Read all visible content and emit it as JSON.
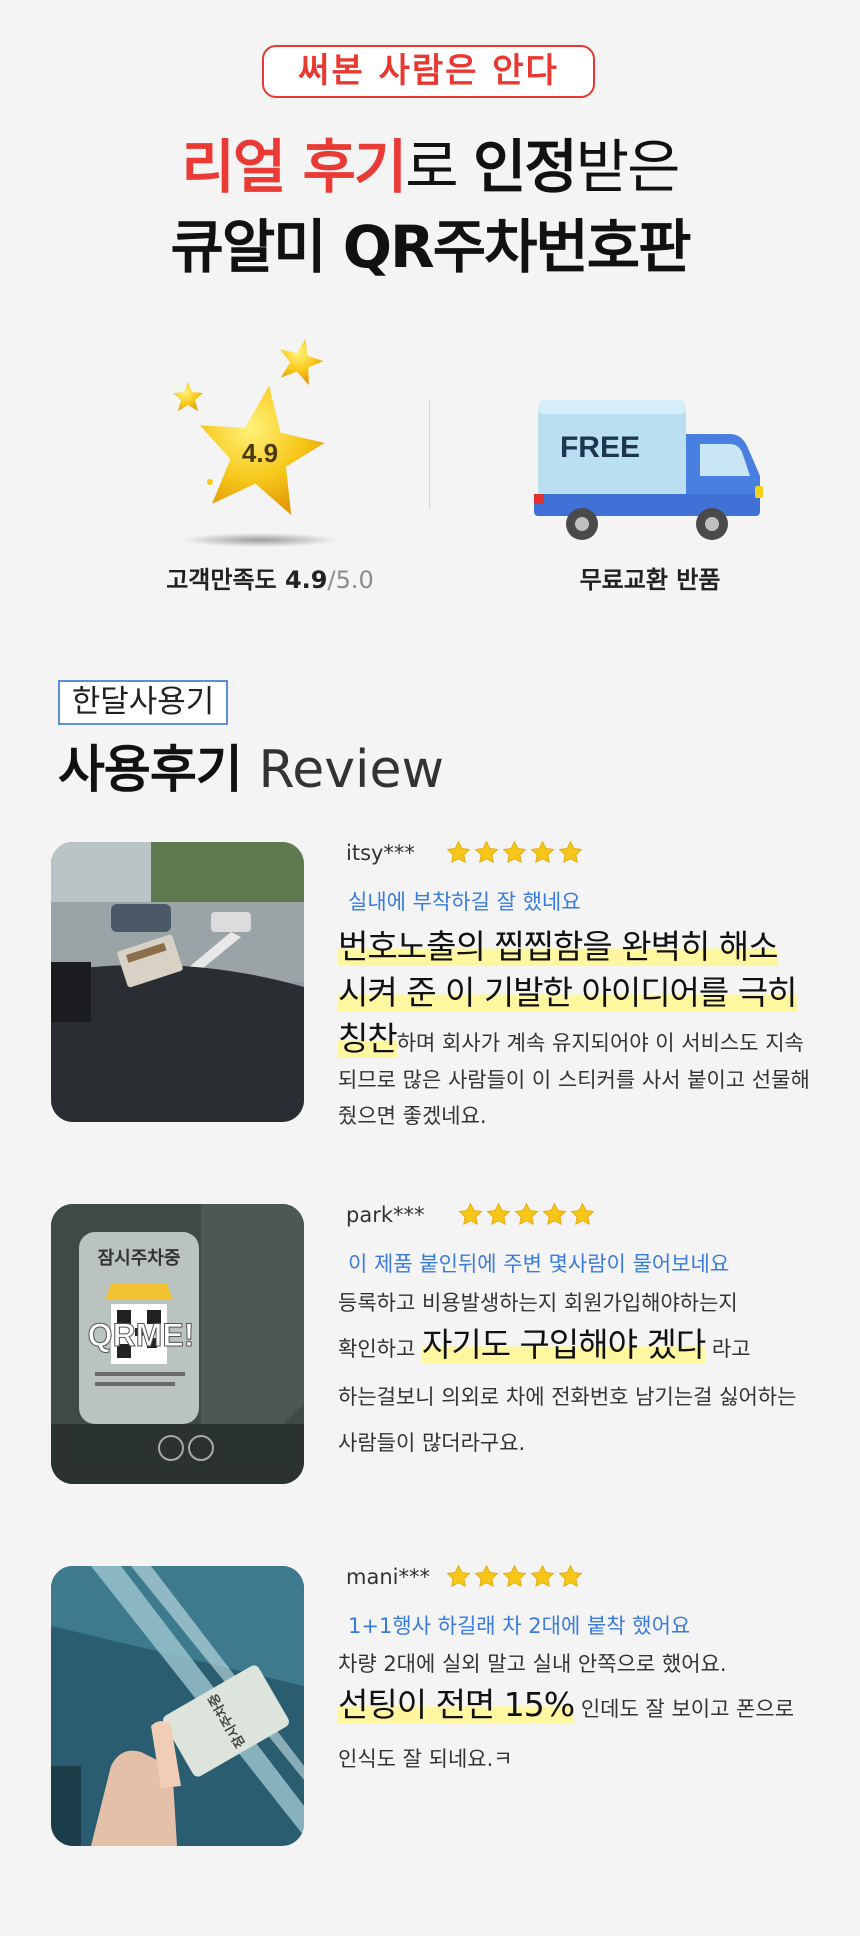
{
  "header": {
    "badge": "써본 사람은 안다",
    "headline_red": "리얼 후기",
    "headline_part1": "로 ",
    "headline_bold": "인정",
    "headline_part2": "받은",
    "headline_line2": "큐알미 QR주차번호판"
  },
  "stats": {
    "rating_value": "4.9",
    "satisfaction_label": "고객만족도 4.9",
    "satisfaction_max": "/5.0",
    "free_text": "FREE",
    "exchange_label": "무료교환 반품"
  },
  "review_section": {
    "tag": "한달사용기",
    "title": "사용후기",
    "title_en": "Review"
  },
  "reviews": [
    {
      "user": "itsy***",
      "rating": 5,
      "title": "실내에 부착하길 잘 했네요",
      "highlight_line1": "번호노출의 찝찝함을 완벽히 해소",
      "highlight_line2": "시켜 준 이 기발한 아이디어를 극히",
      "highlight_line3": "칭찬",
      "rest_line3": "하며 회사가 계속 유지되어야 이 서비스도 지속",
      "rest_line4": "되므로 많은 사람들이 이 스티커를 사서 붙이고 선물해",
      "rest_line5": "줬으면 좋겠네요."
    },
    {
      "user": "park***",
      "rating": 5,
      "title": "이 제품 붙인뒤에 주변 몇사람이 물어보네요",
      "line1": "등록하고 비용발생하는지 회원가입해야하는지",
      "line2_pre": "확인하고 ",
      "line2_hl": "자기도 구입해야 겠다",
      "line2_post": " 라고",
      "line3": "하는걸보니 의외로 차에 전화번호 남기는걸 싫어하는",
      "line4": "사람들이 많더라구요.",
      "photo_sign": "잠시주차중",
      "photo_logo": "QRME!"
    },
    {
      "user": "mani***",
      "rating": 5,
      "title": "1+1행사 하길래 차 2대에 붙착 했어요",
      "line1": "차량 2대에 실외 말고 실내 안쪽으로 했어요.",
      "line2_hl": "선팅이 전면 15%",
      "line2_post": " 인데도 잘 보이고 폰으로",
      "line3": "인식도 잘 되네요.ㅋ",
      "photo_sign": "잠시주차중"
    }
  ],
  "colors": {
    "accent_red": "#ea3a35",
    "link_blue": "#3a7be0",
    "highlight_yellow": "#fff7a0",
    "star_gold": "#f5c518"
  }
}
